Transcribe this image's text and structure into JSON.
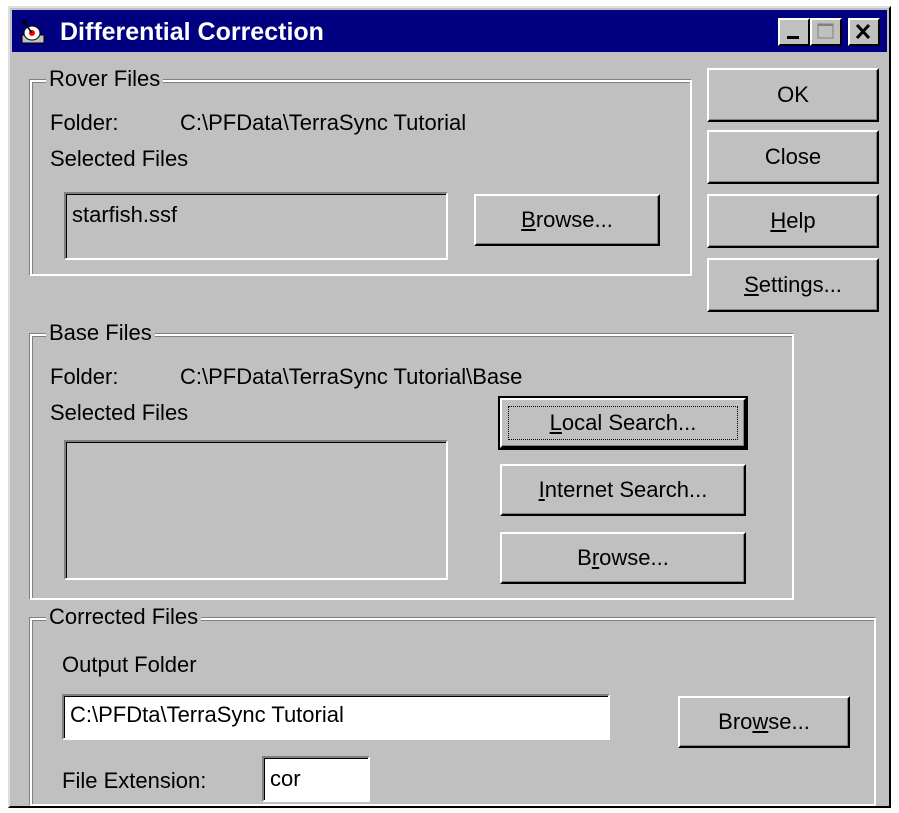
{
  "window": {
    "title": "Differential Correction",
    "app_icon": "satellite-dish-icon"
  },
  "title_buttons": {
    "minimize": "minimize-icon",
    "maximize": "maximize-icon",
    "close": "close-icon"
  },
  "side_buttons": {
    "ok": "OK",
    "close": "Close",
    "help_underline": "H",
    "help_rest": "elp",
    "settings_underline": "S",
    "settings_rest": "ettings..."
  },
  "rover": {
    "legend": "Rover Files",
    "folder_label": "Folder:",
    "folder_value": "C:\\PFData\\TerraSync Tutorial",
    "selected_label": "Selected Files",
    "files": [
      "starfish.ssf"
    ],
    "browse_underline": "B",
    "browse_rest": "rowse..."
  },
  "base": {
    "legend": "Base Files",
    "folder_label": "Folder:",
    "folder_value": "C:\\PFData\\TerraSync Tutorial\\Base",
    "selected_label": "Selected Files",
    "local_underline": "L",
    "local_rest": "ocal Search...",
    "internet_underline": "I",
    "internet_rest": "nternet Search...",
    "browse_pre": "B",
    "browse_underline": "r",
    "browse_rest": "owse..."
  },
  "corrected": {
    "legend": "Corrected Files",
    "output_label_underline": "O",
    "output_label_rest": "utput Folder",
    "output_value": "C:\\PFDta\\TerraSync Tutorial",
    "browse_pre": "Bro",
    "browse_underline": "w",
    "browse_rest": "se...",
    "ext_label_pre": "File ",
    "ext_label_underline": "E",
    "ext_label_rest": "xtension:",
    "ext_value": "cor"
  }
}
